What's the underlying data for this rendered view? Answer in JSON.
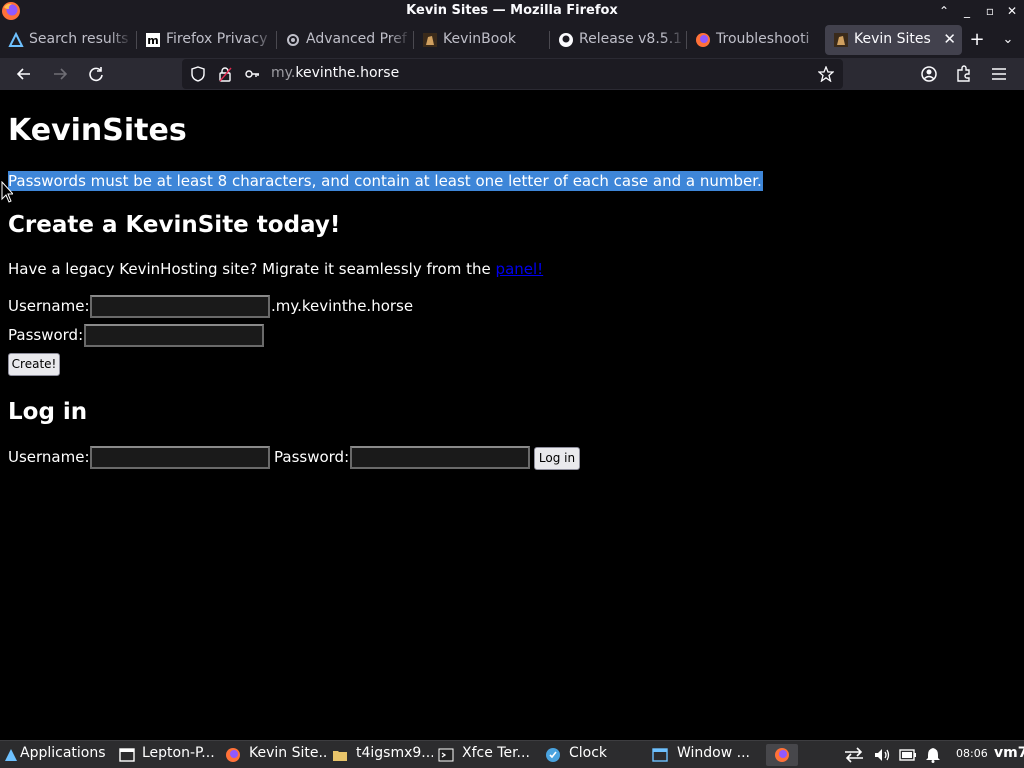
{
  "window": {
    "title": "Kevin Sites — Mozilla Firefox"
  },
  "tabs": [
    {
      "label": "Search results",
      "icon": "search-icon"
    },
    {
      "label": "Firefox Privacy",
      "icon": "m-favicon"
    },
    {
      "label": "Advanced Pref",
      "icon": "gear-icon"
    },
    {
      "label": "KevinBook",
      "icon": "kevin-favicon"
    },
    {
      "label": "Release v8.5.1",
      "icon": "github-icon"
    },
    {
      "label": "Troubleshooti",
      "icon": "firefox-icon"
    },
    {
      "label": "Kevin Sites",
      "icon": "kevin-favicon",
      "active": true
    }
  ],
  "navbar": {
    "url_prefix": "my.",
    "url_domain": "kevinthe.horse"
  },
  "page": {
    "title": "KevinSites",
    "notice": "Passwords must be at least 8 characters, and contain at least one letter of each case and a number.",
    "create": {
      "heading": "Create a KevinSite today!",
      "legacy_text": "Have a legacy KevinHosting site? Migrate it seamlessly from the ",
      "legacy_link": "panel!",
      "username_label": "Username:",
      "domain_suffix": ".my.kevinthe.horse",
      "password_label": "Password:",
      "submit_label": "Create!"
    },
    "login": {
      "heading": "Log in",
      "username_label": "Username:",
      "password_label": "Password:",
      "submit_label": "Log in"
    }
  },
  "taskbar": {
    "items": [
      {
        "label": "Applications",
        "icon": "xfce-menu-icon"
      },
      {
        "label": "Lepton-P...",
        "icon": "window-icon"
      },
      {
        "label": "Kevin Site...",
        "icon": "firefox-icon"
      },
      {
        "label": "t4igsmx9....",
        "icon": "folder-icon"
      },
      {
        "label": "Xfce Ter...",
        "icon": "terminal-icon"
      },
      {
        "label": "Clock",
        "icon": "clock-icon"
      },
      {
        "label": "Window ...",
        "icon": "window-icon"
      }
    ],
    "clock": "08:06",
    "host": "vm7"
  },
  "colors": {
    "selection": "#3e86d8",
    "link": "#0000ee",
    "chrome_dark": "#1c1b22",
    "toolbar": "#2b2a33"
  }
}
